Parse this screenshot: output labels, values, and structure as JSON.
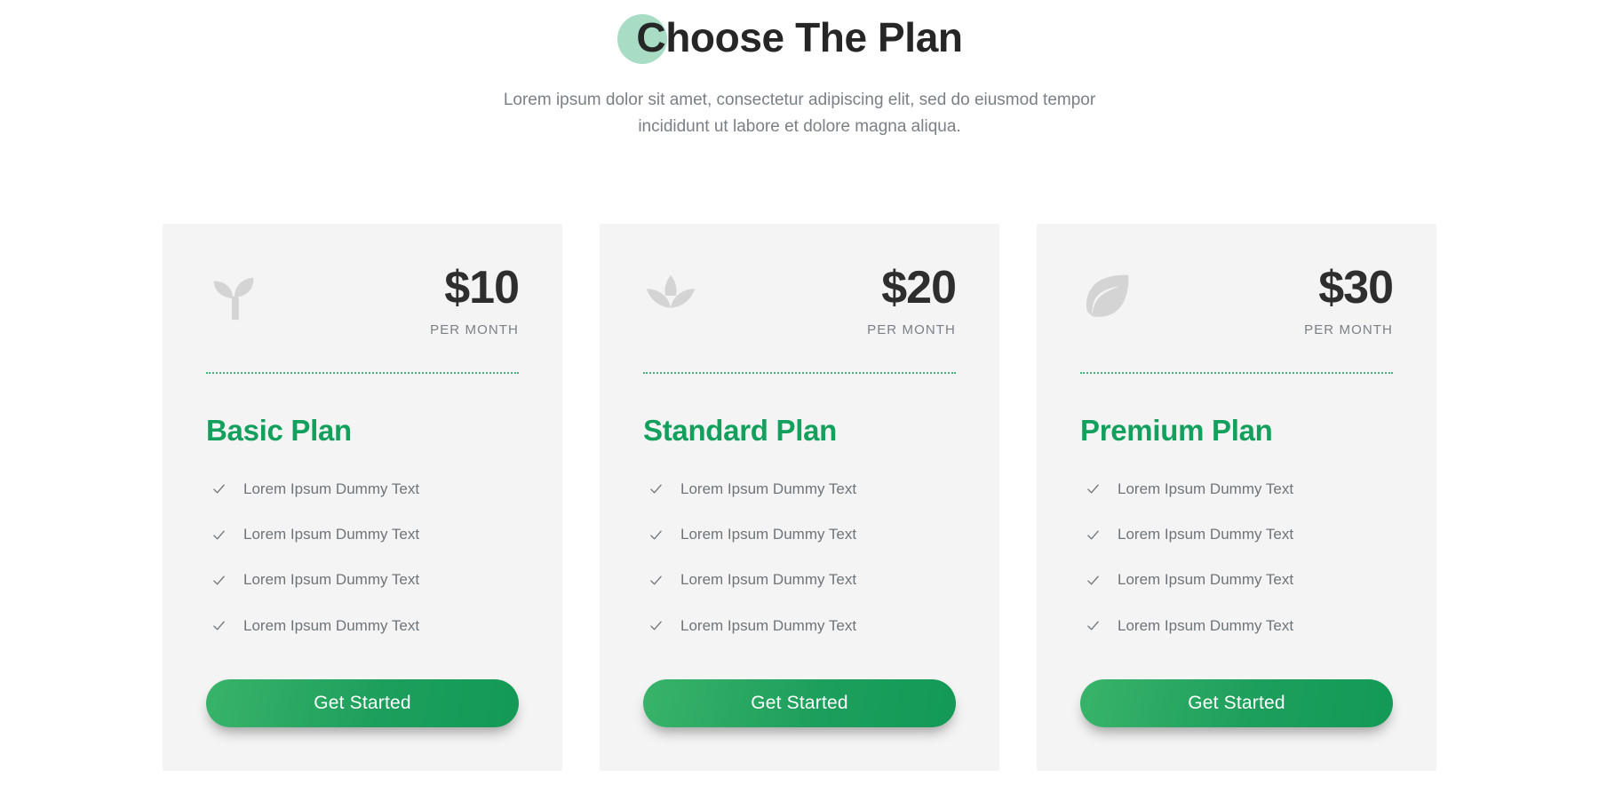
{
  "header": {
    "title": "Choose The Plan",
    "subtitle": "Lorem ipsum dolor sit amet, consectetur adipiscing elit, sed do eiusmod tempor incididunt ut labore et dolore magna aliqua.",
    "accent_circle_color": "#a8dcc5",
    "title_color": "#262626",
    "subtitle_color": "#7b7f86"
  },
  "theme": {
    "card_background": "#f4f4f4",
    "page_background": "#ffffff",
    "brand_green": "#13a05d",
    "divider_green": "#2aa66a",
    "icon_gray": "#d4d4d4",
    "price_color": "#2e2e2e",
    "muted_text": "#6f7479"
  },
  "per_month_label": "PER MONTH",
  "cta_label": "Get Started",
  "check_icon_name": "check-icon",
  "plans": [
    {
      "icon": "seedling-icon",
      "price": "$10",
      "period": "PER MONTH",
      "name": "Basic Plan",
      "features": [
        "Lorem Ipsum Dummy Text",
        "Lorem Ipsum Dummy Text",
        "Lorem Ipsum Dummy Text",
        "Lorem Ipsum Dummy Text"
      ],
      "cta": "Get Started"
    },
    {
      "icon": "lotus-icon",
      "price": "$20",
      "period": "PER MONTH",
      "name": "Standard Plan",
      "features": [
        "Lorem Ipsum Dummy Text",
        "Lorem Ipsum Dummy Text",
        "Lorem Ipsum Dummy Text",
        "Lorem Ipsum Dummy Text"
      ],
      "cta": "Get Started"
    },
    {
      "icon": "leaf-icon",
      "price": "$30",
      "period": "PER MONTH",
      "name": "Premium Plan",
      "features": [
        "Lorem Ipsum Dummy Text",
        "Lorem Ipsum Dummy Text",
        "Lorem Ipsum Dummy Text",
        "Lorem Ipsum Dummy Text"
      ],
      "cta": "Get Started"
    }
  ]
}
